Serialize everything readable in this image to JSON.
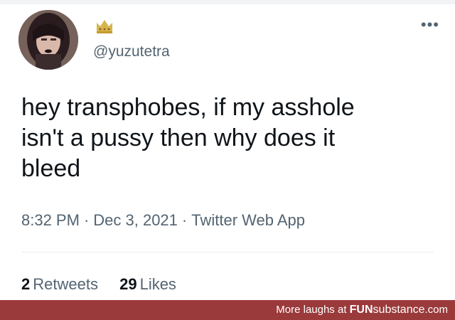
{
  "tweet": {
    "handle": "@yuzutetra",
    "text": "hey transphobes, if my asshole\nisn't a pussy then why does it\nbleed",
    "time": "8:32 PM",
    "separator": "·",
    "date": "Dec 3, 2021",
    "client": "Twitter Web App",
    "retweets_count": "2",
    "retweets_label": "Retweets",
    "likes_count": "29",
    "likes_label": "Likes",
    "more_icon": "more-horizontal-icon",
    "crown_icon": "crown-icon"
  },
  "footer": {
    "prefix": "More laughs at ",
    "brand_bold": "FUN",
    "brand_rest": "substance",
    "suffix": ".com"
  },
  "colors": {
    "text": "#0f1419",
    "muted": "#536471",
    "footer_bg": "#9b3a3b",
    "crown": "#d6b64a"
  }
}
